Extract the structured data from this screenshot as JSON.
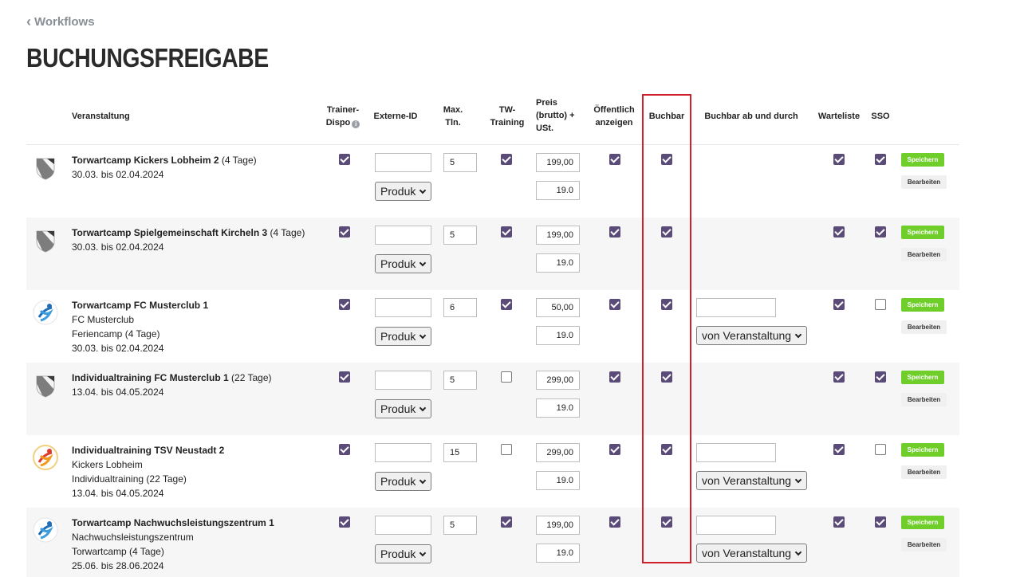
{
  "nav": {
    "back_label": "Workflows"
  },
  "page_title": "BUCHUNGSFREIGABE",
  "columns": {
    "veranstaltung": "Veranstaltung",
    "trainer_dispo_1": "Trainer-",
    "trainer_dispo_2": "Dispo",
    "externe_id": "Externe-ID",
    "max_tln_1": "Max.",
    "max_tln_2": "Tln.",
    "tw_training_1": "TW-",
    "tw_training_2": "Training",
    "preis_1": "Preis",
    "preis_2": "(brutto) +",
    "preis_3": "USt.",
    "oeffentlich_1": "Öffentlich",
    "oeffentlich_2": "anzeigen",
    "buchbar": "Buchbar",
    "buchbar_ab": "Buchbar ab und durch",
    "warteliste": "Warteliste",
    "sso": "SSO"
  },
  "labels": {
    "produkt_select": "Produk",
    "von_veranstaltung": "von Veranstaltung",
    "save": "Speichern",
    "edit": "Bearbeiten"
  },
  "rows": [
    {
      "name": "Torwartcamp Kickers Lobheim 2",
      "suffix": " (4 Tage)",
      "lines": [
        "30.03. bis 02.04.2024"
      ],
      "logo": "shield-logo",
      "max_tln": "5",
      "price": "199,00",
      "vat": "19.0",
      "trainer_dispo": true,
      "tw_training": true,
      "oeffentlich": true,
      "buchbar": true,
      "warteliste": true,
      "sso": true,
      "buchbar_ab": false
    },
    {
      "name": "Torwartcamp Spielgemeinschaft Kircheln 3",
      "suffix": " (4 Tage)",
      "lines": [
        "30.03. bis 02.04.2024"
      ],
      "logo": "shield-logo",
      "max_tln": "5",
      "price": "199,00",
      "vat": "19.0",
      "trainer_dispo": true,
      "tw_training": true,
      "oeffentlich": true,
      "buchbar": true,
      "warteliste": true,
      "sso": true,
      "buchbar_ab": false
    },
    {
      "name": "Torwartcamp FC Musterclub 1",
      "suffix": "",
      "lines": [
        "FC Musterclub",
        "Feriencamp (4 Tage)",
        "30.03. bis 02.04.2024"
      ],
      "logo": "keeper-blue-logo",
      "max_tln": "6",
      "price": "50,00",
      "vat": "19.0",
      "trainer_dispo": true,
      "tw_training": true,
      "oeffentlich": true,
      "buchbar": true,
      "warteliste": true,
      "sso": false,
      "buchbar_ab": true
    },
    {
      "name": "Individualtraining FC Musterclub 1",
      "suffix": " (22 Tage)",
      "lines": [
        "13.04. bis 04.05.2024"
      ],
      "logo": "shield-logo",
      "max_tln": "5",
      "price": "299,00",
      "vat": "19.0",
      "trainer_dispo": true,
      "tw_training": false,
      "oeffentlich": true,
      "buchbar": true,
      "warteliste": true,
      "sso": true,
      "buchbar_ab": false
    },
    {
      "name": "Individualtraining TSV Neustadt 2",
      "suffix": "",
      "lines": [
        "Kickers Lobheim",
        "Individualtraining (22 Tage)",
        "13.04. bis 04.05.2024"
      ],
      "logo": "keeper-red-logo",
      "max_tln": "15",
      "price": "299,00",
      "vat": "19.0",
      "trainer_dispo": true,
      "tw_training": false,
      "oeffentlich": true,
      "buchbar": true,
      "warteliste": true,
      "sso": false,
      "buchbar_ab": true
    },
    {
      "name": "Torwartcamp Nachwuchsleistungszentrum 1",
      "suffix": "",
      "lines": [
        "Nachwuchsleistungszentrum",
        "Torwartcamp (4 Tage)",
        "25.06. bis 28.06.2024"
      ],
      "logo": "keeper-blue-logo",
      "max_tln": "5",
      "price": "199,00",
      "vat": "19.0",
      "trainer_dispo": true,
      "tw_training": true,
      "oeffentlich": true,
      "buchbar": true,
      "warteliste": true,
      "sso": true,
      "buchbar_ab": true
    }
  ]
}
